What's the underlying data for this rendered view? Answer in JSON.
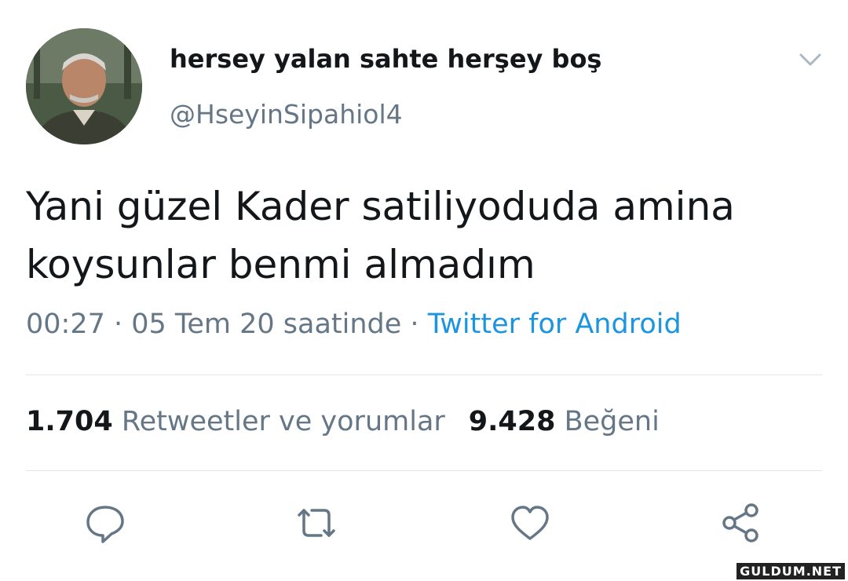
{
  "tweet": {
    "display_name": "hersey yalan sahte herşey boş",
    "handle": "@HseyinSipahiol4",
    "text_line1": "Yani güzel Kader satiliyoduda amina",
    "text_line2": "koysunlar benmi almadım",
    "time": "00:27",
    "separator": " · ",
    "date": "05 Tem 20 saatinde",
    "source": "Twitter for Android"
  },
  "stats": {
    "retweets_count": "1.704",
    "retweets_label": "Retweetler ve yorumlar",
    "likes_count": "9.428",
    "likes_label": "Beğeni"
  },
  "actions": [
    "reply-icon",
    "retweet-icon",
    "like-icon",
    "share-icon"
  ],
  "icons": {
    "more": "chevron-down-icon"
  },
  "colors": {
    "text_primary": "#14171a",
    "text_secondary": "#657786",
    "link": "#1b95e0",
    "divider": "#e1e8ed"
  },
  "watermark": "GULDUM.NET"
}
